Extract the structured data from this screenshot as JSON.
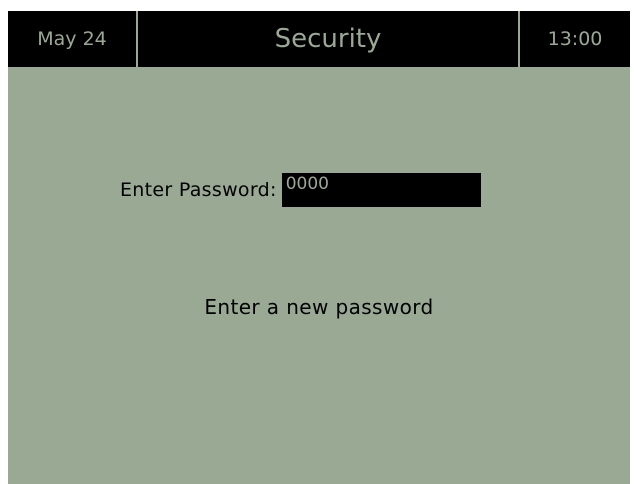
{
  "header": {
    "date": "May 24",
    "title": "Security",
    "time": "13:00"
  },
  "password": {
    "label": "Enter Password:",
    "value": "0000"
  },
  "message": "Enter a new password",
  "colors": {
    "screen_background": "#99a994",
    "header_background": "#000000",
    "header_text": "#99a994",
    "body_text": "#000000",
    "input_background": "#000000",
    "input_text": "#99a994"
  }
}
